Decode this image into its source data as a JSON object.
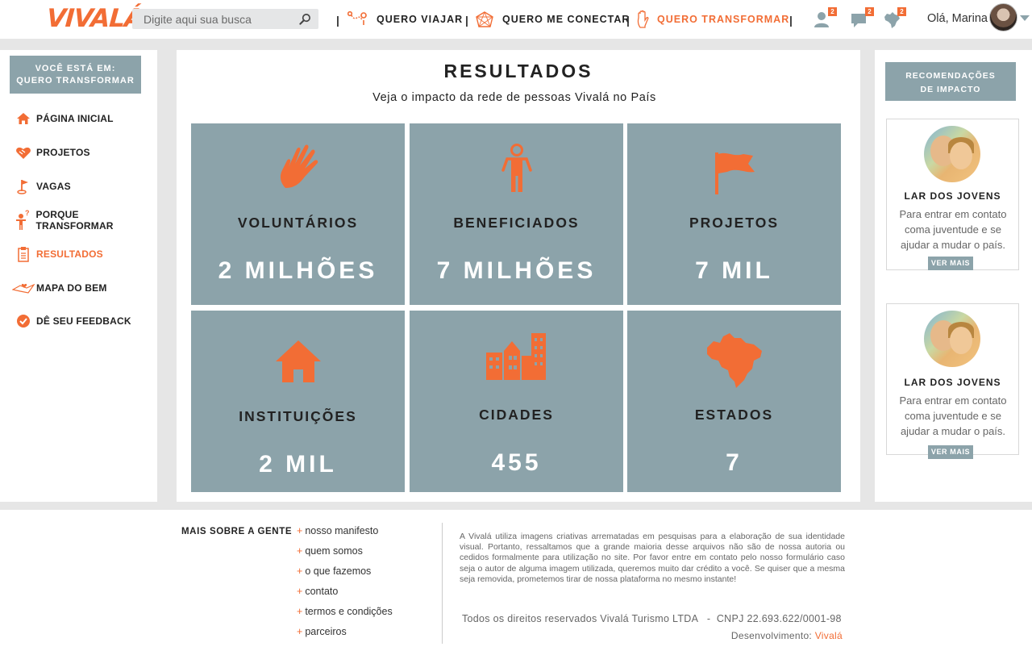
{
  "header": {
    "logo": "VIVALÁ",
    "search": {
      "placeholder": "Digite aqui sua busca"
    },
    "nav": [
      {
        "label": "QUERO VIAJAR"
      },
      {
        "label": "QUERO ME CONECTAR"
      },
      {
        "label": "QUERO TRANSFORMAR",
        "active": true
      }
    ],
    "badges": {
      "users": "2",
      "messages": "2",
      "map": "2"
    },
    "greeting": "Olá, Marina"
  },
  "sidebar": {
    "you_are_line1": "VOCÊ ESTÁ EM:",
    "you_are_line2": "QUERO TRANSFORMAR",
    "items": [
      {
        "label": "PÁGINA INICIAL",
        "icon": "home-icon"
      },
      {
        "label": "PROJETOS",
        "icon": "heart-hands-icon"
      },
      {
        "label": "VAGAS",
        "icon": "flag-icon"
      },
      {
        "label": "PORQUE TRANSFORMAR",
        "icon": "person-question-icon"
      },
      {
        "label": "RESULTADOS",
        "icon": "clipboard-icon",
        "active": true
      },
      {
        "label": "MAPA DO BEM",
        "icon": "map-heart-icon"
      },
      {
        "label": "DÊ SEU FEEDBACK",
        "icon": "check-circle-icon"
      }
    ]
  },
  "main": {
    "title": "RESULTADOS",
    "subtitle": "Veja o impacto da rede de pessoas Vivalá no País",
    "tiles": [
      {
        "label": "VOLUNTÁRIOS",
        "value": "2 MILHÕES",
        "icon": "hand-icon"
      },
      {
        "label": "BENEFICIADOS",
        "value": "7 MILHÕES",
        "icon": "person-icon"
      },
      {
        "label": "PROJETOS",
        "value": "7 MIL",
        "icon": "flag-icon"
      },
      {
        "label": "INSTITUIÇÕES",
        "value": "2 MIL",
        "icon": "house-icon"
      },
      {
        "label": "CIDADES",
        "value": "455",
        "icon": "city-icon"
      },
      {
        "label": "ESTADOS",
        "value": "7",
        "icon": "brazil-map-icon"
      }
    ]
  },
  "recommendations": {
    "title_line1": "RECOMENDAÇÕES",
    "title_line2": "DE IMPACTO",
    "cards": [
      {
        "title": "LAR DOS JOVENS",
        "text": "Para entrar em contato coma juventude e se ajudar a mudar o país.",
        "button": "VER MAIS"
      },
      {
        "title": "LAR DOS JOVENS",
        "text": "Para entrar em contato coma juventude e se ajudar a mudar o país.",
        "button": "VER MAIS"
      }
    ]
  },
  "footer": {
    "heading": "MAIS SOBRE A GENTE",
    "links": [
      "nosso manifesto",
      "quem somos",
      "o que fazemos",
      "contato",
      "termos e condições",
      "parceiros"
    ],
    "disclaimer": "A Vivalá utiliza imagens criativas arrematadas em pesquisas para a elaboração de sua identidade visual. Portanto, ressaltamos que a grande maioria desse arquivos não são de nossa autoria ou cedidos formalmente para utilização no site. Por favor entre em contato pelo nosso formulário caso seja o autor de alguma imagem utilizada, queremos muito dar crédito a você. Se quiser que a mesma seja removida, prometemos tirar de nossa plataforma no mesmo instante!",
    "rights": "Todos os direitos reservados Vivalá Turismo LTDA   -  CNPJ 22.693.622/0001-98",
    "dev_label": "Desenvolvimento:",
    "dev_brand": "Vivalá"
  },
  "colors": {
    "accent": "#f26d35",
    "tile": "#8ca3aa",
    "background": "#e6e6e6"
  }
}
